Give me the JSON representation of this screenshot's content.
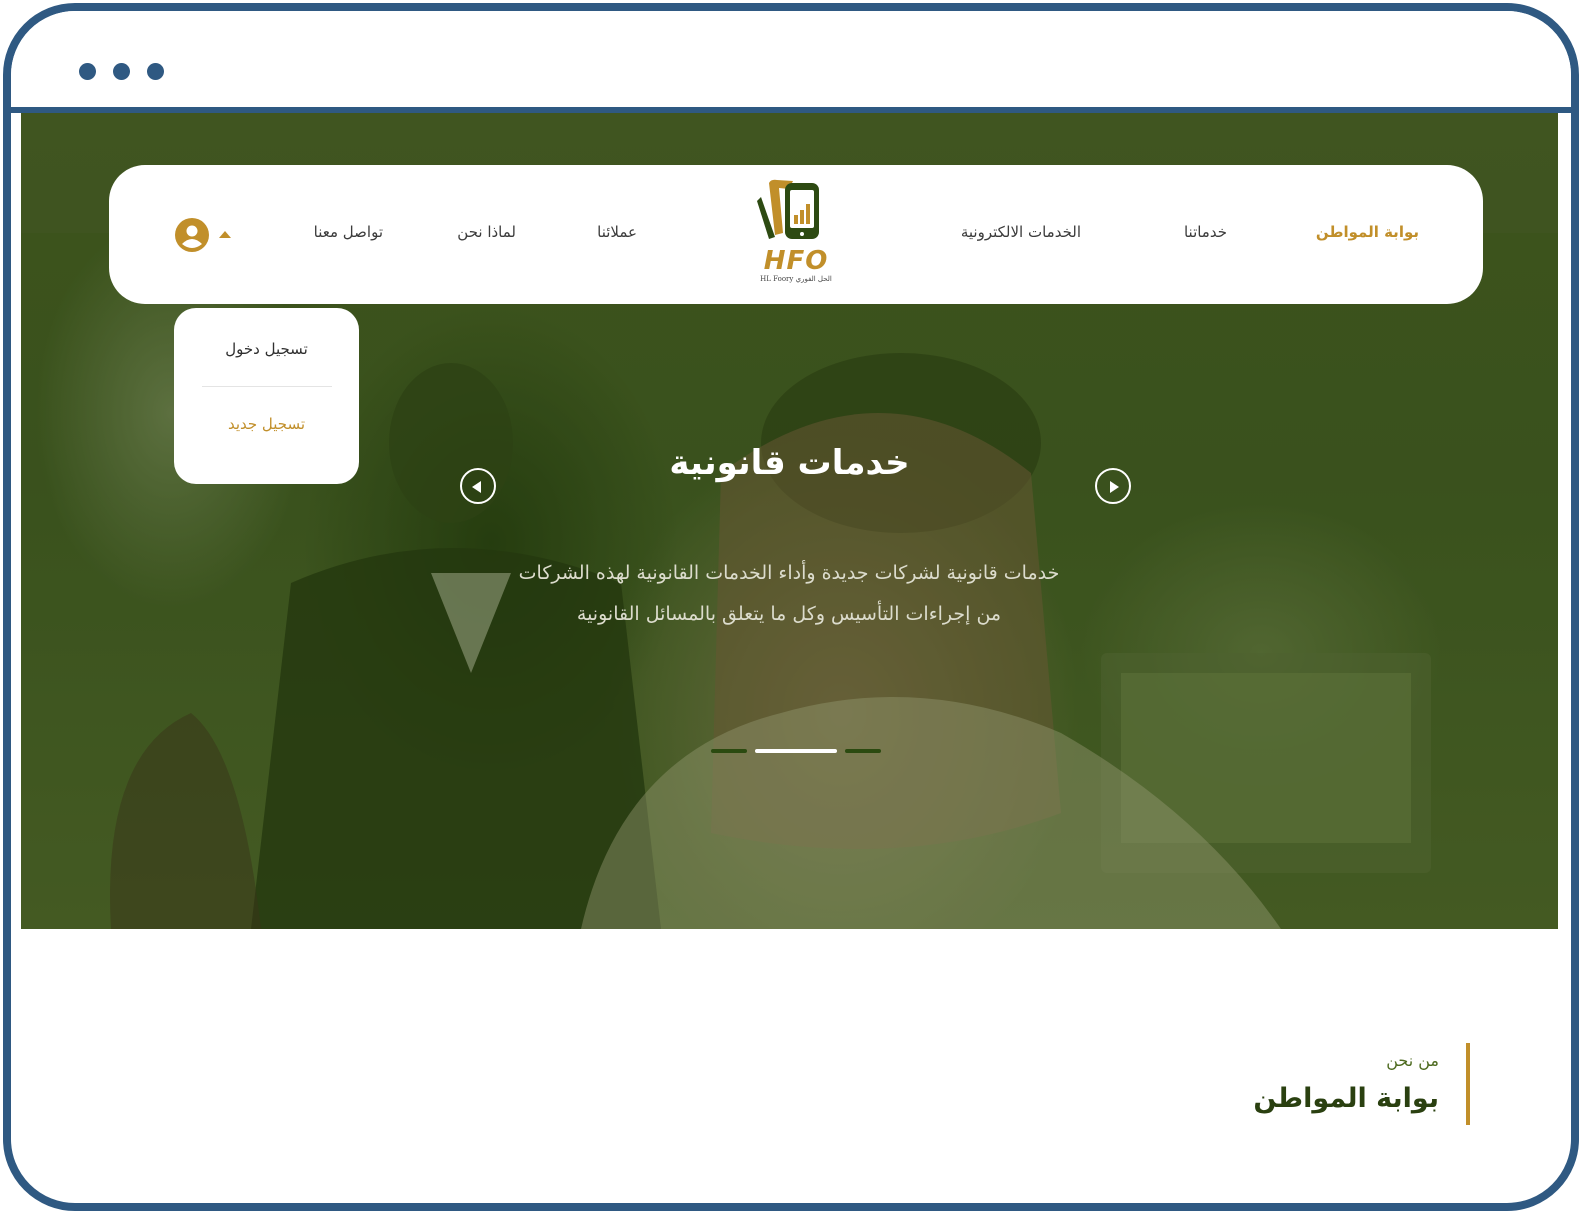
{
  "colors": {
    "frame": "#2f5982",
    "brand_gold": "#c18f2a",
    "brand_green": "#2d4a12",
    "hero_overlay": "#3f5a1e"
  },
  "nav": {
    "items": [
      {
        "label": "بوابة المواطن",
        "active": true
      },
      {
        "label": "خدماتنا",
        "active": false
      },
      {
        "label": "الخدمات الالكترونية",
        "active": false
      },
      {
        "label": "عملائنا",
        "active": false
      },
      {
        "label": "لماذا نحن",
        "active": false
      },
      {
        "label": "تواصل معنا",
        "active": false
      }
    ],
    "logo": {
      "text": "HFO",
      "subtitle": "HL Foory الحل الفوري"
    },
    "user_icon": "user-circle-icon",
    "dropdown_toggle_icon": "caret-up-icon"
  },
  "user_menu": {
    "login": "تسجيل دخول",
    "register": "تسجيل جديد"
  },
  "hero": {
    "title": "خدمات قانونية",
    "description_line1": "خدمات قانونية لشركات جديدة وأداء الخدمات القانونية لهذه الشركات",
    "description_line2": "من إجراءات التأسيس وكل ما يتعلق بالمسائل القانونية",
    "prev_icon": "arrow-left-icon",
    "next_icon": "arrow-right-icon",
    "slides_count": 3,
    "active_slide": 2
  },
  "about": {
    "eyebrow": "من نحن",
    "title": "بوابة المواطن"
  }
}
